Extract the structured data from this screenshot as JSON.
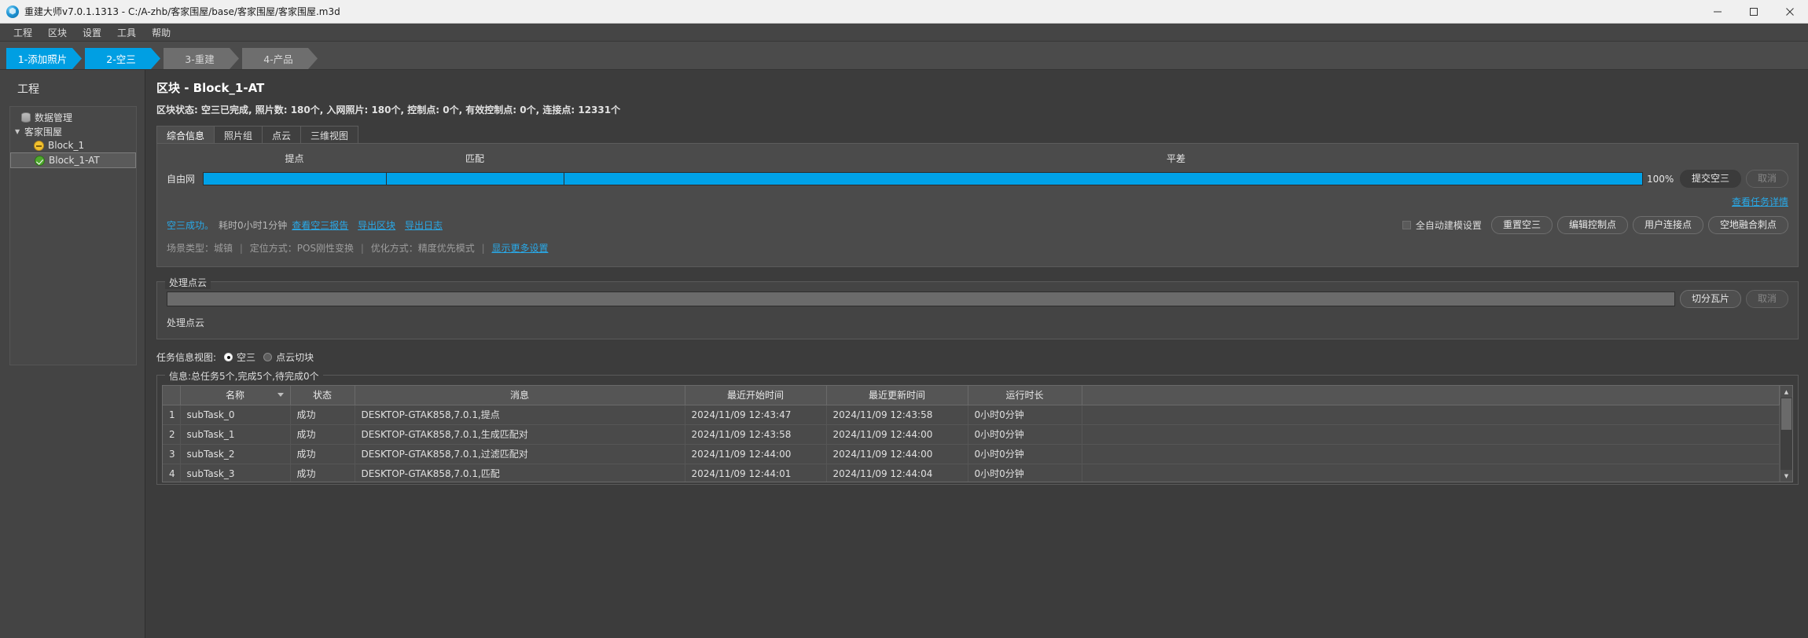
{
  "titlebar": {
    "text": "重建大师v7.0.1.1313 - C:/A-zhb/客家围屋/base/客家围屋/客家围屋.m3d",
    "minimize": "minimize-icon",
    "maximize": "maximize-icon",
    "close": "close-icon"
  },
  "menu": {
    "items": [
      {
        "label": "工程"
      },
      {
        "label": "区块"
      },
      {
        "label": "设置"
      },
      {
        "label": "工具"
      },
      {
        "label": "帮助"
      }
    ]
  },
  "steps": [
    {
      "label": "1-添加照片",
      "state": "active"
    },
    {
      "label": "2-空三",
      "state": "active"
    },
    {
      "label": "3-重建",
      "state": "inactive"
    },
    {
      "label": "4-产品",
      "state": "inactive"
    }
  ],
  "sidebar": {
    "title": "工程",
    "tree": [
      {
        "label": "数据管理",
        "icon": "database-icon",
        "indent": 1,
        "selected": false
      },
      {
        "label": "客家围屋",
        "icon": "none",
        "indent": 0,
        "expanded": true,
        "selected": false
      },
      {
        "label": "Block_1",
        "icon": "status-pending-icon",
        "indent": 2,
        "selected": false
      },
      {
        "label": "Block_1-AT",
        "icon": "status-success-icon",
        "indent": 2,
        "selected": true
      }
    ]
  },
  "main": {
    "block_title": "区块 - Block_1-AT",
    "block_status": "区块状态: 空三已完成, 照片数: 180个, 入网照片: 180个, 控制点: 0个, 有效控制点: 0个, 连接点: 12331个",
    "tabs": [
      {
        "label": "综合信息",
        "active": true
      },
      {
        "label": "照片组",
        "active": false
      },
      {
        "label": "点云",
        "active": false
      },
      {
        "label": "三维视图",
        "active": false
      }
    ],
    "phases": [
      {
        "label": "提点"
      },
      {
        "label": "匹配"
      },
      {
        "label": "平差"
      }
    ],
    "progress": {
      "row_label": "自由网",
      "percent": "100%",
      "submit_button": "提交空三",
      "cancel_button": "取消",
      "task_detail_link": "查看任务详情"
    },
    "result": {
      "status_text": "空三成功。",
      "elapsed_text": "耗时0小时1分钟",
      "links": [
        {
          "label": "查看空三报告"
        },
        {
          "label": "导出区块"
        },
        {
          "label": "导出日志"
        }
      ],
      "auto_model_checkbox": "全自动建模设置",
      "buttons": [
        {
          "label": "重置空三"
        },
        {
          "label": "编辑控制点"
        },
        {
          "label": "用户连接点"
        },
        {
          "label": "空地融合刺点"
        }
      ]
    },
    "settings_line": {
      "scene_type": "场景类型：城镇",
      "position_method": "定位方式：POS刚性变换",
      "optimize_method": "优化方式：精度优先模式",
      "more_link": "显示更多设置"
    },
    "pointcloud": {
      "legend": "处理点云",
      "caption": "处理点云",
      "tile_button": "切分瓦片",
      "cancel_button": "取消"
    },
    "taskview": {
      "label": "任务信息视图:",
      "options": [
        {
          "label": "空三",
          "selected": true
        },
        {
          "label": "点云切块",
          "selected": false
        }
      ],
      "info_legend": "信息:总任务5个,完成5个,待完成0个",
      "table": {
        "columns": [
          "名称",
          "状态",
          "消息",
          "最近开始时间",
          "最近更新时间",
          "运行时长"
        ],
        "rows": [
          {
            "index": "1",
            "name": "subTask_0",
            "status": "成功",
            "message": "DESKTOP-GTAK858,7.0.1,提点",
            "start_time": "2024/11/09 12:43:47",
            "update_time": "2024/11/09 12:43:58",
            "duration": "0小时0分钟"
          },
          {
            "index": "2",
            "name": "subTask_1",
            "status": "成功",
            "message": "DESKTOP-GTAK858,7.0.1,生成匹配对",
            "start_time": "2024/11/09 12:43:58",
            "update_time": "2024/11/09 12:44:00",
            "duration": "0小时0分钟"
          },
          {
            "index": "3",
            "name": "subTask_2",
            "status": "成功",
            "message": "DESKTOP-GTAK858,7.0.1,过滤匹配对",
            "start_time": "2024/11/09 12:44:00",
            "update_time": "2024/11/09 12:44:00",
            "duration": "0小时0分钟"
          },
          {
            "index": "4",
            "name": "subTask_3",
            "status": "成功",
            "message": "DESKTOP-GTAK858,7.0.1,匹配",
            "start_time": "2024/11/09 12:44:01",
            "update_time": "2024/11/09 12:44:04",
            "duration": "0小时0分钟"
          }
        ]
      }
    }
  },
  "colors": {
    "accent": "#00a2e8",
    "link": "#29a9e8",
    "success": "#4fa82e",
    "pending": "#f2c12e"
  }
}
